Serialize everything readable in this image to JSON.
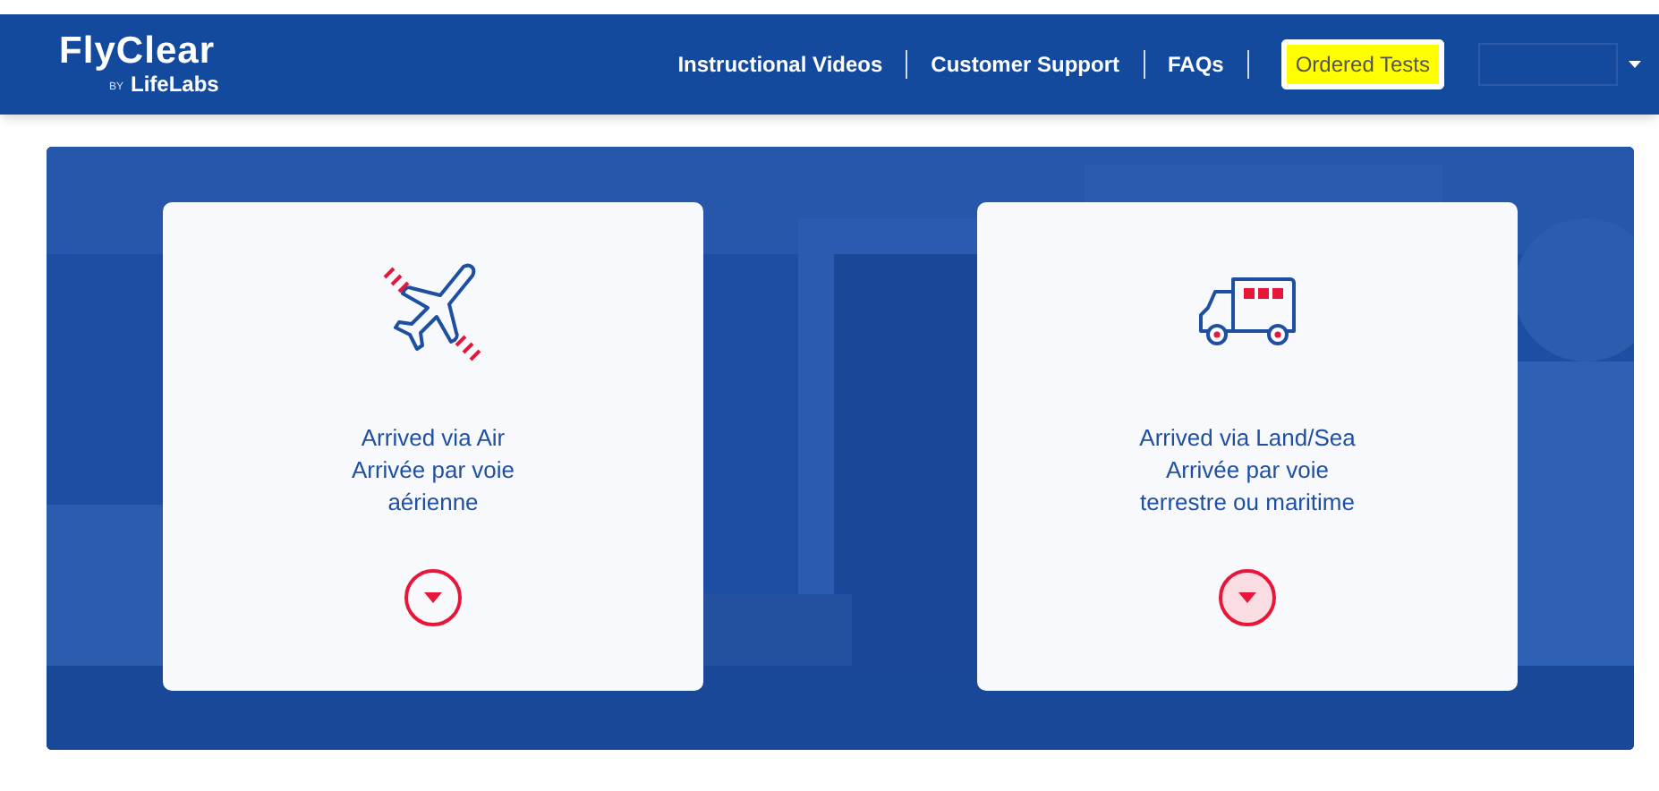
{
  "logo": {
    "title": "FlyClear",
    "by": "BY",
    "brand": "LifeLabs"
  },
  "nav": {
    "links": [
      {
        "label": "Instructional Videos"
      },
      {
        "label": "Customer Support"
      },
      {
        "label": "FAQs"
      }
    ],
    "button": {
      "label": "Ordered Tests",
      "highlighted": true
    }
  },
  "cards": [
    {
      "kind": "plane",
      "lines": [
        "Arrived via Air",
        "Arrivée par voie",
        "aérienne"
      ],
      "expand_highlighted": false
    },
    {
      "kind": "truck",
      "lines": [
        "Arrived via Land/Sea",
        "Arrivée par voie",
        "terrestre ou maritime"
      ],
      "expand_highlighted": true
    }
  ]
}
